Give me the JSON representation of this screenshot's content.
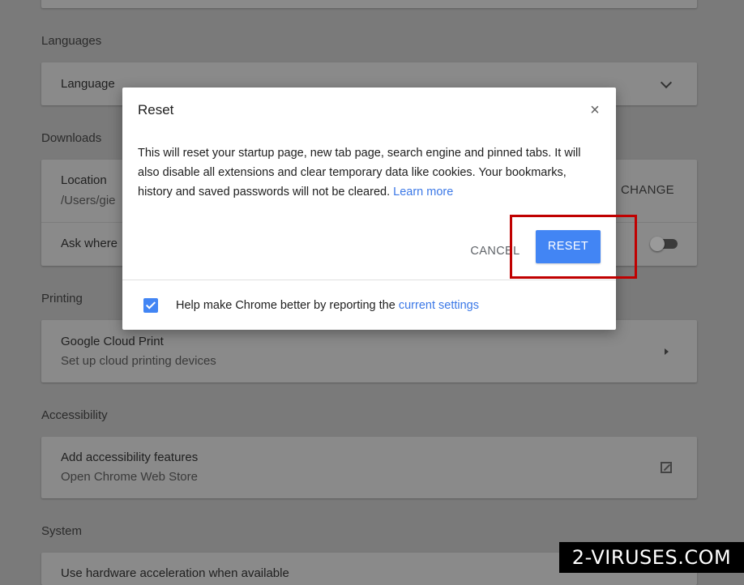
{
  "settings": {
    "languages_section": "Languages",
    "language_row": "Language",
    "downloads_section": "Downloads",
    "location_label": "Location",
    "location_path": "/Users/gie",
    "change_button": "CHANGE",
    "ask_where_label": "Ask where",
    "printing_section": "Printing",
    "cloud_print_label": "Google Cloud Print",
    "cloud_print_sub": "Set up cloud printing devices",
    "accessibility_section": "Accessibility",
    "accessibility_label": "Add accessibility features",
    "accessibility_sub": "Open Chrome Web Store",
    "system_section": "System",
    "hardware_accel_label": "Use hardware acceleration when available"
  },
  "dialog": {
    "title": "Reset",
    "close_glyph": "×",
    "body_text": "This will reset your startup page, new tab page, search engine and pinned tabs. It will also disable all extensions and clear temporary data like cookies. Your bookmarks, history and saved passwords will not be cleared.",
    "learn_more": "Learn more",
    "cancel_button": "CANCEL",
    "reset_button": "RESET",
    "checkbox_checked": true,
    "checkbox_label": "Help make Chrome better by reporting the",
    "checkbox_link": "current settings"
  },
  "watermark": "2-VIRUSES.COM",
  "colors": {
    "accent_blue": "#4285f4",
    "link_blue": "#3b78e7",
    "highlight_red": "#c00000"
  }
}
